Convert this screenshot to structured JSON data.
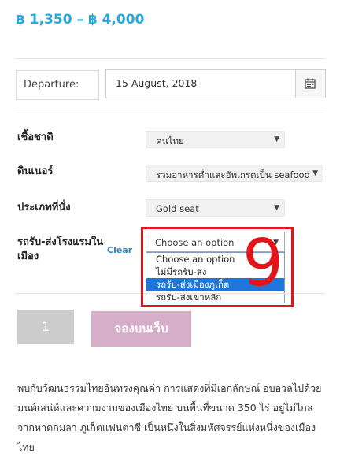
{
  "price": "฿ 1,350 – ฿ 4,000",
  "departure": {
    "label": "Departure:",
    "date": "15 August, 2018",
    "calendar_icon": "calendar-icon"
  },
  "fields": [
    {
      "label": "เชื้อชาติ",
      "value": "คนไทย"
    },
    {
      "label": "ดินเนอร์",
      "value": "รวมอาหารค่ำและอัพเกรดเป็น seafood"
    },
    {
      "label": "ประเภทที่นั่ง",
      "value": "Gold seat"
    }
  ],
  "transfer": {
    "label_line1": "รถรับ-ส่งโรงแรมใน",
    "label_line2": "เมือง",
    "clear": "Clear",
    "selected": "Choose an option",
    "options": [
      "Choose an option",
      "ไม่มีรถรับ-ส่ง",
      "รถรับ-ส่งเมืองภูเก็ต",
      "รถรับ-ส่งเขาหลัก"
    ],
    "highlighted_index": 2
  },
  "annotation_number": "9",
  "quantity": "1",
  "book_button": "จองบนเว็บ",
  "description": "พบกับวัฒนธรรมไทยอันทรงคุณค่า การแสดงที่มีเอกลักษณ์ อบอวลไปด้วยมนต์เสน่ห์และความงามของเมืองไทย บนพื้นที่ขนาด 350 ไร่ อยู่ไม่ไกลจากหาดกมลา ภูเก็ตแฟนตาซี เป็นหนึ่งในสิ่งมหัศจรรย์แห่งหนึ่งของเมืองไทย",
  "colors": {
    "accent": "#2aa7df",
    "highlight": "#e3141a",
    "book": "#d6aec9",
    "selected_option": "#1f76d8"
  }
}
